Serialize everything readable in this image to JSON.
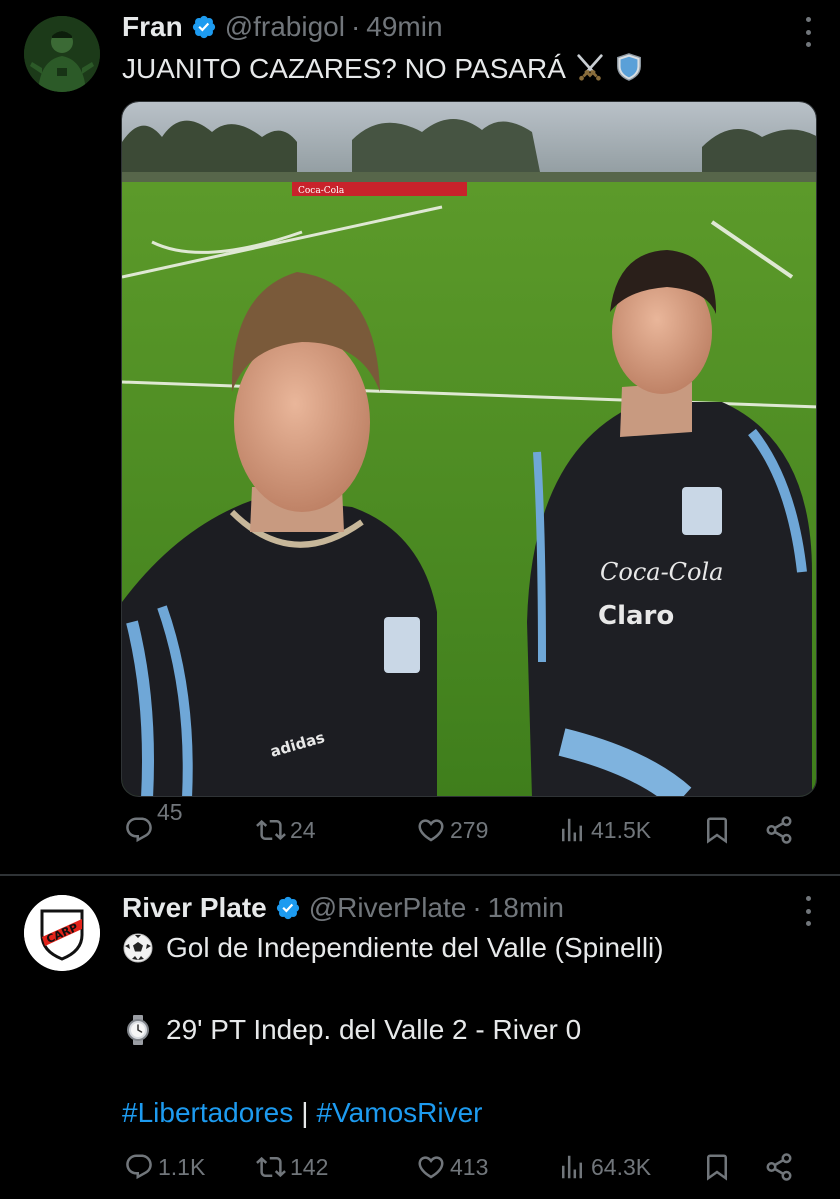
{
  "tweets": [
    {
      "display_name": "Fran",
      "handle": "@frabigol",
      "separator": "·",
      "time": "49min",
      "text": "JUANITO CAZARES? NO PASARÁ",
      "text_emojis": [
        "crossed-swords-icon",
        "shield-icon"
      ],
      "media": {
        "billboard_text": "Coca-Cola",
        "shirt_brand": "adidas",
        "sponsor_1": "Coca-Cola",
        "sponsor_2": "Claro"
      },
      "actions": {
        "replies": "45",
        "retweets": "24",
        "likes": "279",
        "views": "41.5K"
      }
    },
    {
      "display_name": "River Plate",
      "handle": "@RiverPlate",
      "separator": "·",
      "time": "18min",
      "lines": {
        "line1": "Gol de Independiente del Valle (Spinelli)",
        "line2": "29' PT Indep. del Valle 2 - River 0",
        "hashtag1": "#Libertadores",
        "pipe": "|",
        "hashtag2": "#VamosRiver"
      },
      "avatar_text": "CARP",
      "actions": {
        "replies": "1.1K",
        "retweets": "142",
        "likes": "413",
        "views": "64.3K"
      }
    }
  ],
  "colors": {
    "background": "#000000",
    "text": "#e7e9ea",
    "muted": "#71767b",
    "link": "#1d9bf0",
    "verified": "#1d9bf0",
    "divider": "#2f3336",
    "river_red": "#e2231a"
  }
}
